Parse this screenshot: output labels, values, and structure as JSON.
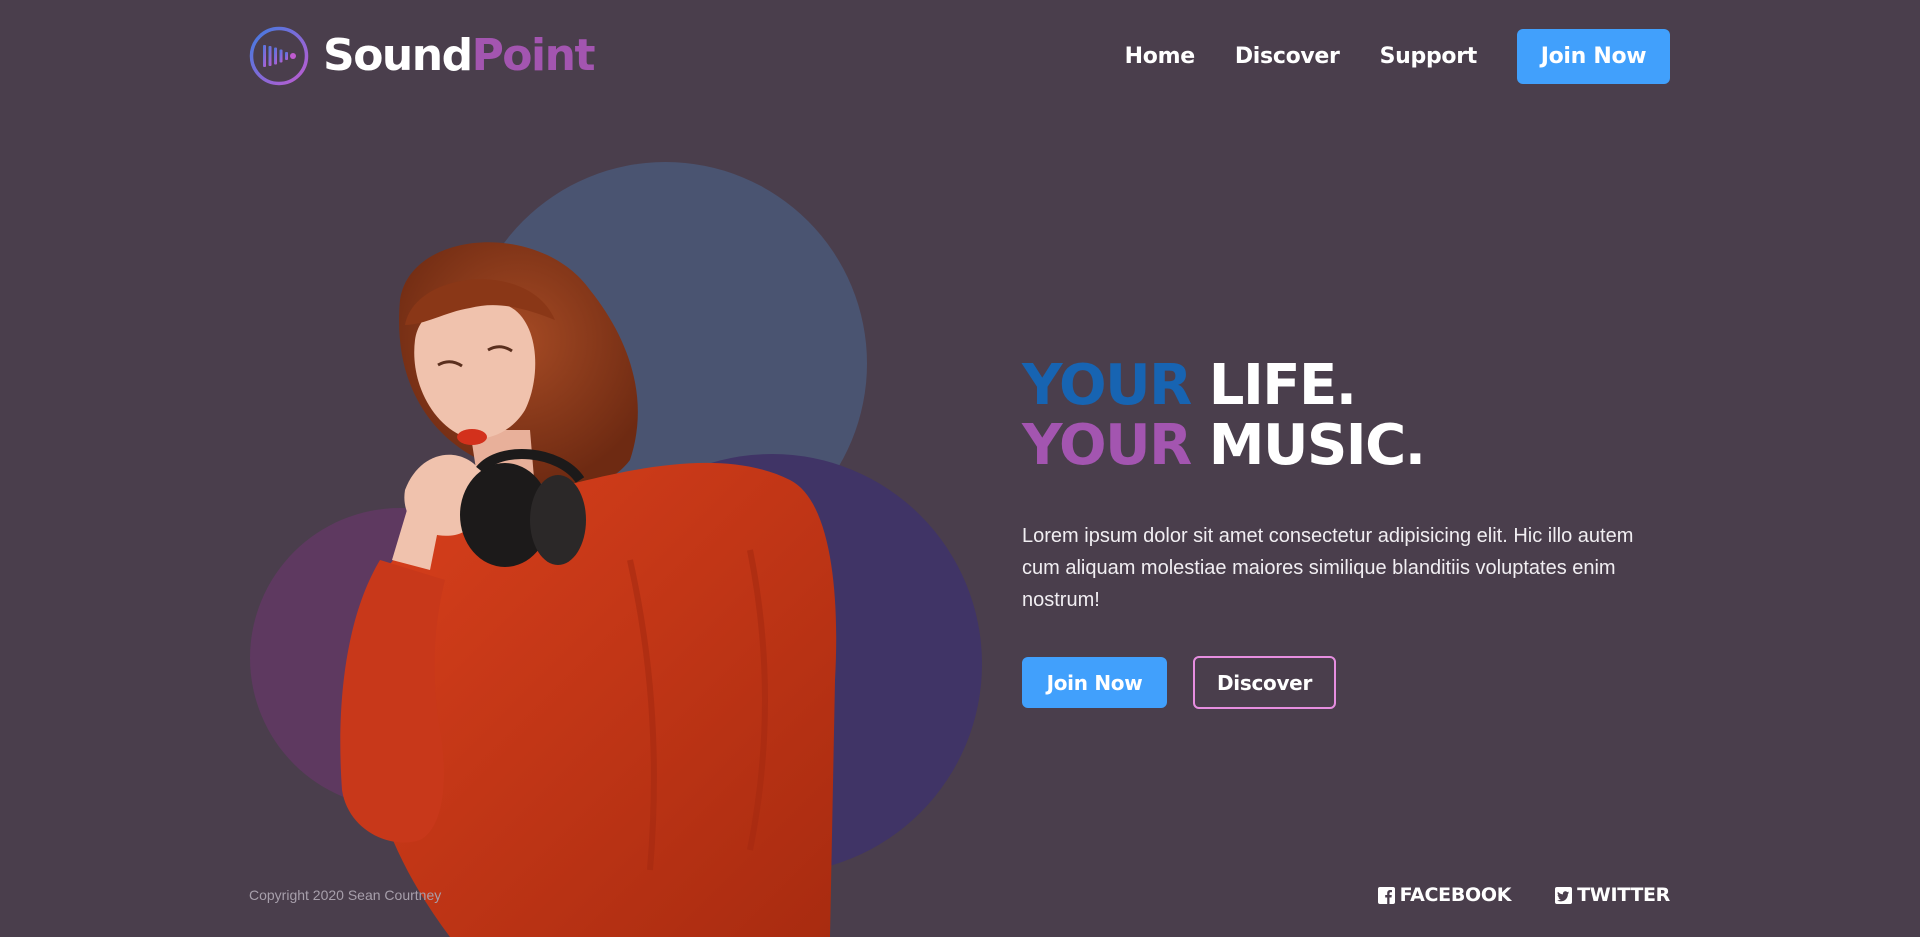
{
  "brand": {
    "name_part1": "Sound",
    "name_part2": "Point"
  },
  "nav": {
    "items": [
      {
        "label": "Home"
      },
      {
        "label": "Discover"
      },
      {
        "label": "Support"
      }
    ],
    "join_label": "Join Now"
  },
  "hero": {
    "line1_accent": "YOUR",
    "line1_rest": "LIFE.",
    "line2_accent": "YOUR",
    "line2_rest": "MUSIC.",
    "description": "Lorem ipsum dolor sit amet consectetur adipisicing elit. Hic illo autem cum aliquam molestiae maiores similique blanditiis voluptates enim nostrum!",
    "join_label": "Join Now",
    "discover_label": "Discover"
  },
  "footer": {
    "copyright": "Copyright 2020 Sean Courtney",
    "facebook_label": "FACEBOOK",
    "twitter_label": "TWITTER"
  },
  "colors": {
    "background": "#4a3e4c",
    "primary_blue": "#41a0fc",
    "accent_blue": "#1764b2",
    "accent_purple": "#a355b0",
    "discover_border": "#e68ee0"
  },
  "icons": {
    "logo": "soundwave-logo-icon",
    "facebook": "facebook-icon",
    "twitter": "twitter-icon"
  }
}
